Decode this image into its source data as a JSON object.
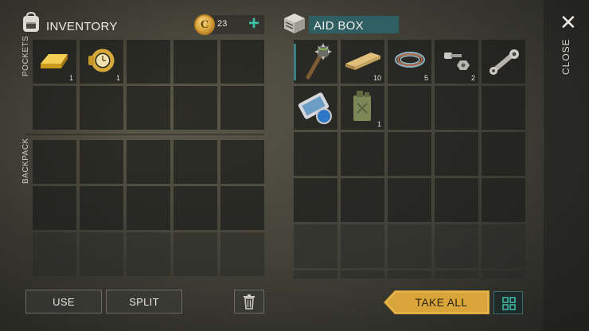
{
  "inventory": {
    "title": "INVENTORY",
    "pockets_label": "POCKETS",
    "backpack_label": "BACKPACK",
    "currency": {
      "count": "23",
      "add_symbol": "+"
    },
    "pockets": [
      {
        "item": "gold-bar",
        "qty": "1"
      },
      {
        "item": "gold-watch",
        "qty": "1"
      },
      {
        "item": null,
        "qty": ""
      },
      {
        "item": null,
        "qty": ""
      },
      {
        "item": null,
        "qty": ""
      },
      {
        "item": null,
        "qty": ""
      },
      {
        "item": null,
        "qty": ""
      },
      {
        "item": null,
        "qty": ""
      },
      {
        "item": null,
        "qty": ""
      },
      {
        "item": null,
        "qty": ""
      }
    ]
  },
  "aid_box": {
    "title": "AID BOX",
    "items": [
      {
        "item": "spiked-mace",
        "qty": ""
      },
      {
        "item": "wooden-plank",
        "qty": "10"
      },
      {
        "item": "wire",
        "qty": "5"
      },
      {
        "item": "bolts",
        "qty": "2"
      },
      {
        "item": "piston-rod",
        "qty": ""
      },
      {
        "item": "blueprint-map",
        "qty": ""
      },
      {
        "item": "fuel-canister",
        "qty": "1"
      }
    ]
  },
  "buttons": {
    "use": "USE",
    "split": "SPLIT",
    "take_all": "TAKE ALL",
    "close": "CLOSE",
    "close_symbol": "✕"
  },
  "colors": {
    "accent_teal": "#3ec1ab",
    "take_all": "#d9a53a",
    "title_bar": "#2f5f63"
  }
}
